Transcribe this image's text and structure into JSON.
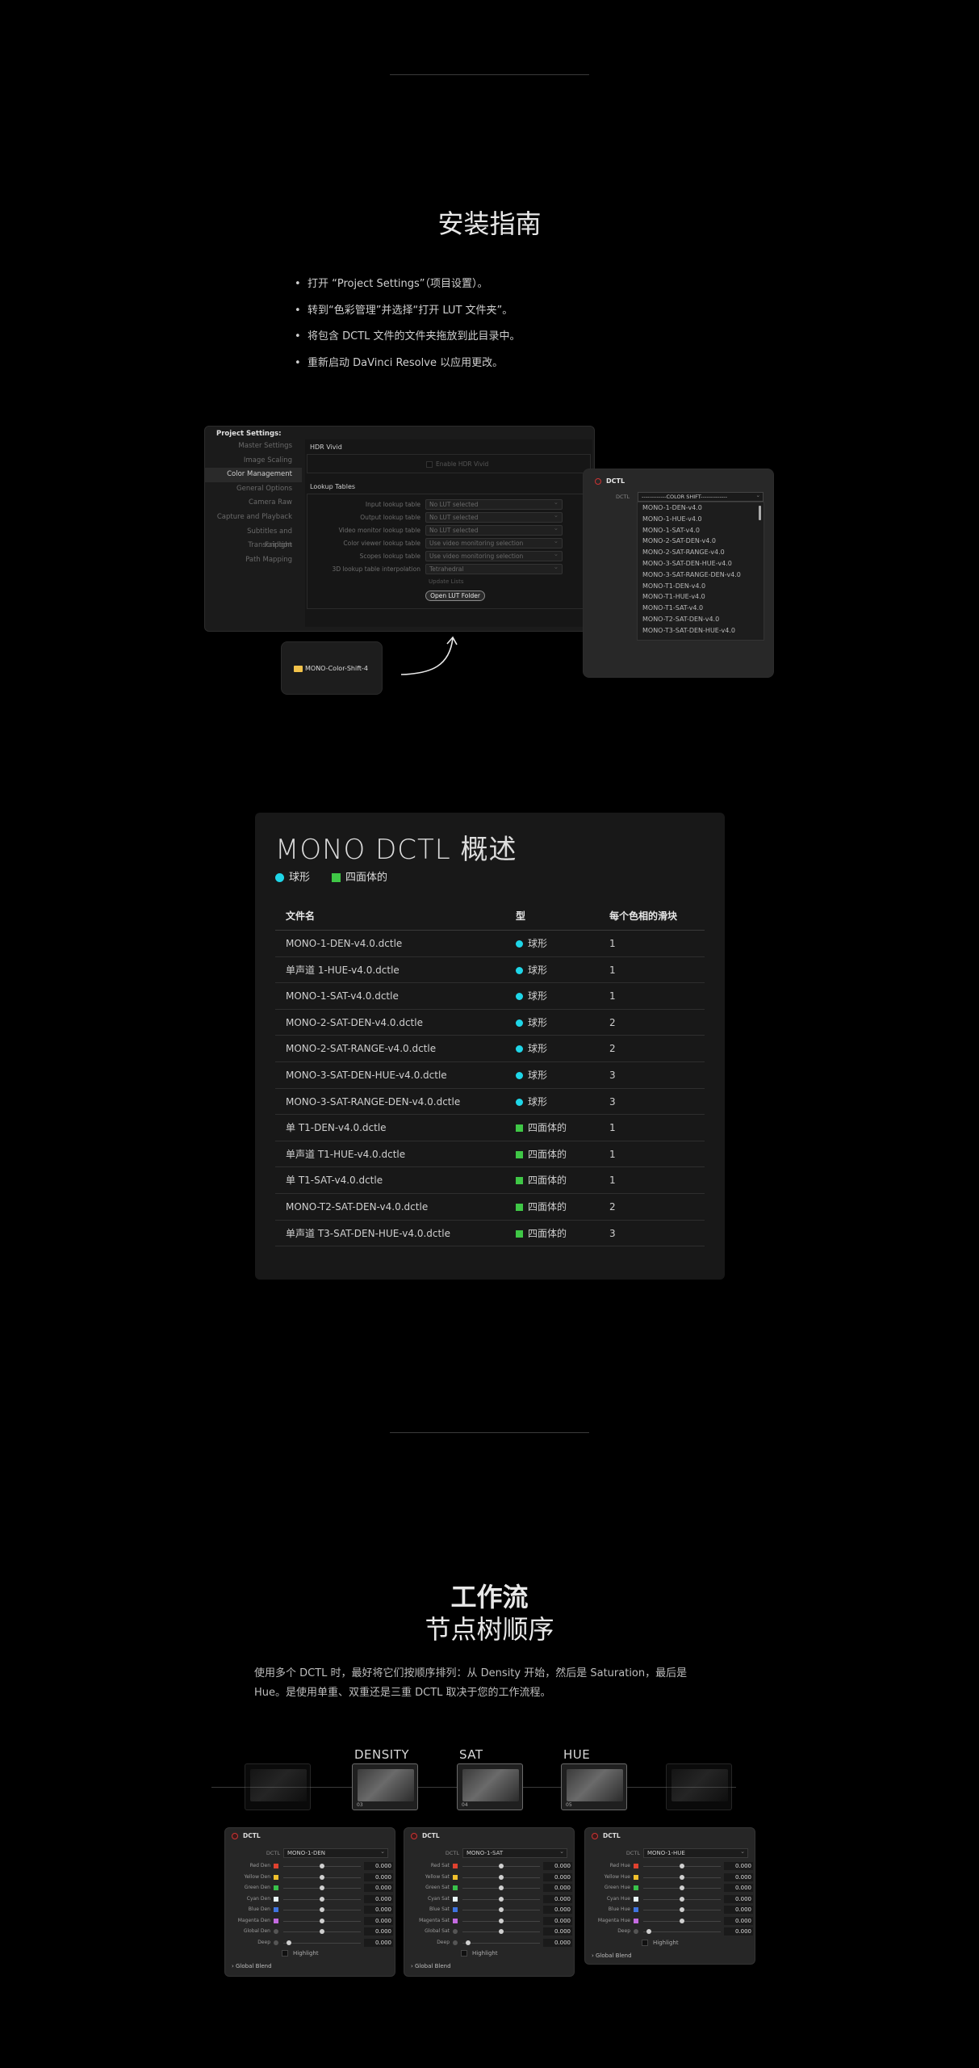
{
  "install": {
    "title": "安装指南",
    "steps": [
      "打开 “Project Settings”（项目设置）。",
      "转到“色彩管理”并选择“打开 LUT 文件夹”。",
      "将包含 DCTL 文件的文件夹拖放到此目录中。",
      "重新启动 DaVinci Resolve 以应用更改。"
    ]
  },
  "project_settings": {
    "title": "Project Settings:",
    "sidebar": [
      "Master Settings",
      "Image Scaling",
      "Color Management",
      "General Options",
      "Camera Raw",
      "Capture and Playback",
      "Subtitles and Transcription",
      "Fairlight",
      "Path Mapping"
    ],
    "active_item": "Color Management",
    "hdr_section": "HDR Vivid",
    "hdr_checkbox": "Enable HDR Vivid",
    "lookup_section": "Lookup Tables",
    "rows": [
      {
        "label": "Input lookup table",
        "value": "No LUT selected"
      },
      {
        "label": "Output lookup table",
        "value": "No LUT selected"
      },
      {
        "label": "Video monitor lookup table",
        "value": "No LUT selected"
      },
      {
        "label": "Color viewer lookup table",
        "value": "Use video monitoring selection"
      },
      {
        "label": "Scopes lookup table",
        "value": "Use video monitoring selection"
      },
      {
        "label": "3D lookup table interpolation",
        "value": "Tetrahedral"
      }
    ],
    "update_lists": "Update Lists",
    "open_lut_folder": "Open LUT Folder",
    "folder_name": "MONO-Color-Shift-4"
  },
  "dctl_popup": {
    "title": "DCTL",
    "label": "DCTL",
    "selected": "-------------COLOR SHIFT--------------",
    "items": [
      "MONO-1-DEN-v4.0",
      "MONO-1-HUE-v4.0",
      "MONO-1-SAT-v4.0",
      "MONO-2-SAT-DEN-v4.0",
      "MONO-2-SAT-RANGE-v4.0",
      "MONO-3-SAT-DEN-HUE-v4.0",
      "MONO-3-SAT-RANGE-DEN-v4.0",
      "MONO-T1-DEN-v4.0",
      "MONO-T1-HUE-v4.0",
      "MONO-T1-SAT-v4.0",
      "MONO-T2-SAT-DEN-v4.0",
      "MONO-T3-SAT-DEN-HUE-v4.0"
    ]
  },
  "overview": {
    "title": "MONO DCTL 概述",
    "legend": [
      {
        "label": "球形",
        "color": "#1fd6e8"
      },
      {
        "label": "四面体的",
        "color": "#3fc746"
      }
    ],
    "headers": [
      "文件名",
      "型",
      "每个色相的滑块"
    ],
    "rows": [
      {
        "file": "MONO-1-DEN-v4.0.dctle",
        "type": "球形",
        "shape": "sphere",
        "sliders": "1"
      },
      {
        "file": "单声道 1-HUE-v4.0.dctle",
        "type": "球形",
        "shape": "sphere",
        "sliders": "1"
      },
      {
        "file": "MONO-1-SAT-v4.0.dctle",
        "type": "球形",
        "shape": "sphere",
        "sliders": "1"
      },
      {
        "file": "MONO-2-SAT-DEN-v4.0.dctle",
        "type": "球形",
        "shape": "sphere",
        "sliders": "2"
      },
      {
        "file": "MONO-2-SAT-RANGE-v4.0.dctle",
        "type": "球形",
        "shape": "sphere",
        "sliders": "2"
      },
      {
        "file": "MONO-3-SAT-DEN-HUE-v4.0.dctle",
        "type": "球形",
        "shape": "sphere",
        "sliders": "3"
      },
      {
        "file": "MONO-3-SAT-RANGE-DEN-v4.0.dctle",
        "type": "球形",
        "shape": "sphere",
        "sliders": "3"
      },
      {
        "file": "单 T1-DEN-v4.0.dctle",
        "type": "四面体的",
        "shape": "tetra",
        "sliders": "1"
      },
      {
        "file": "单声道 T1-HUE-v4.0.dctle",
        "type": "四面体的",
        "shape": "tetra",
        "sliders": "1"
      },
      {
        "file": "单 T1-SAT-v4.0.dctle",
        "type": "四面体的",
        "shape": "tetra",
        "sliders": "1"
      },
      {
        "file": "MONO-T2-SAT-DEN-v4.0.dctle",
        "type": "四面体的",
        "shape": "tetra",
        "sliders": "2"
      },
      {
        "file": "单声道 T3-SAT-DEN-HUE-v4.0.dctle",
        "type": "四面体的",
        "shape": "tetra",
        "sliders": "3"
      }
    ]
  },
  "workflow": {
    "title": "工作流",
    "subtitle": "节点树顺序",
    "description": "使用多个 DCTL 时，最好将它们按顺序排列：从 Density 开始，然后是 Saturation，最后是 Hue。是使用单重、双重还是三重 DCTL 取决于您的工作流程。",
    "node_labels": [
      "DENSITY",
      "SAT",
      "HUE"
    ],
    "node_numbers": [
      "03",
      "04",
      "05"
    ],
    "panels": [
      {
        "title": "DCTL",
        "dctl_label": "DCTL",
        "dctl_value": "MONO-1-DEN",
        "rows": [
          {
            "label": "Red Den",
            "color": "#e0412f",
            "value": "0.000"
          },
          {
            "label": "Yellow Den",
            "color": "#f0c02c",
            "value": "0.000"
          },
          {
            "label": "Green Den",
            "color": "#39c24a",
            "value": "0.000"
          },
          {
            "label": "Cyan Den",
            "color": "#e8f6f8",
            "value": "0.000"
          },
          {
            "label": "Blue Den",
            "color": "#3f74e0",
            "value": "0.000"
          },
          {
            "label": "Magenta Den",
            "color": "#c46ae0",
            "value": "0.000"
          },
          {
            "label": "Global Den",
            "color": "",
            "value": "0.000"
          },
          {
            "label": "Deep",
            "color": "",
            "value": "0.000"
          }
        ],
        "highlight": "Highlight",
        "blend": "Global Blend"
      },
      {
        "title": "DCTL",
        "dctl_label": "DCTL",
        "dctl_value": "MONO-1-SAT",
        "rows": [
          {
            "label": "Red Sat",
            "color": "#e0412f",
            "value": "0.000"
          },
          {
            "label": "Yellow Sat",
            "color": "#f0c02c",
            "value": "0.000"
          },
          {
            "label": "Green Sat",
            "color": "#39c24a",
            "value": "0.000"
          },
          {
            "label": "Cyan Sat",
            "color": "#e8f6f8",
            "value": "0.000"
          },
          {
            "label": "Blue Sat",
            "color": "#3f74e0",
            "value": "0.000"
          },
          {
            "label": "Magenta Sat",
            "color": "#c46ae0",
            "value": "0.000"
          },
          {
            "label": "Global Sat",
            "color": "",
            "value": "0.000"
          },
          {
            "label": "Deep",
            "color": "",
            "value": "0.000"
          }
        ],
        "highlight": "Highlight",
        "blend": "Global Blend"
      },
      {
        "title": "DCTL",
        "dctl_label": "DCTL",
        "dctl_value": "MONO-1-HUE",
        "rows": [
          {
            "label": "Red Hue",
            "color": "#e0412f",
            "value": "0.000"
          },
          {
            "label": "Yellow Hue",
            "color": "#f0c02c",
            "value": "0.000"
          },
          {
            "label": "Green Hue",
            "color": "#39c24a",
            "value": "0.000"
          },
          {
            "label": "Cyan Hue",
            "color": "#e8f6f8",
            "value": "0.000"
          },
          {
            "label": "Blue Hue",
            "color": "#3f74e0",
            "value": "0.000"
          },
          {
            "label": "Magenta Hue",
            "color": "#c46ae0",
            "value": "0.000"
          },
          {
            "label": "Deep",
            "color": "",
            "value": "0.000"
          }
        ],
        "highlight": "Highlight",
        "blend": "Global Blend"
      }
    ]
  }
}
